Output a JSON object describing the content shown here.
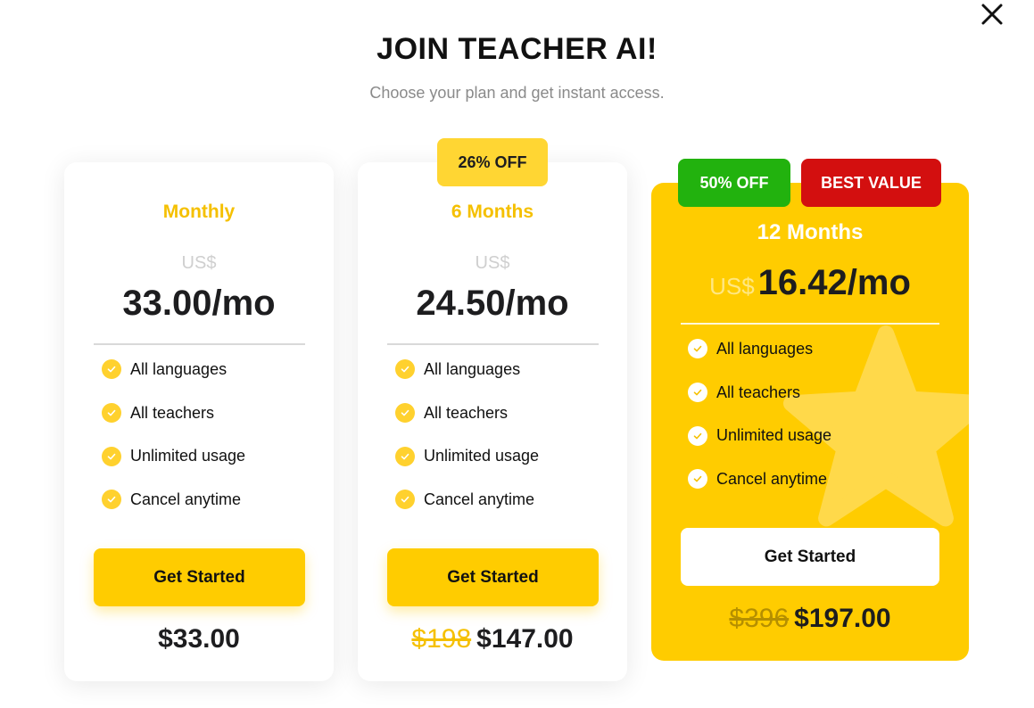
{
  "header": {
    "title": "JOIN TEACHER AI!",
    "subtitle": "Choose your plan and get instant access."
  },
  "features": [
    "All languages",
    "All teachers",
    "Unlimited usage",
    "Cancel anytime"
  ],
  "colors": {
    "brand_yellow": "#FFCC00",
    "discount_green": "#22B20E",
    "best_value_red": "#D30F0F"
  },
  "plans": [
    {
      "name": "Monthly",
      "currency": "US$",
      "price": "33.00/mo",
      "cta": "Get Started",
      "total": "$33.00"
    },
    {
      "name": "6 Months",
      "badge": "26% OFF",
      "currency": "US$",
      "price": "24.50/mo",
      "cta": "Get Started",
      "total_original": "$198",
      "total": "$147.00"
    },
    {
      "name": "12 Months",
      "badges": [
        "50% OFF",
        "BEST VALUE"
      ],
      "currency": "US$",
      "price": "16.42/mo",
      "cta": "Get Started",
      "total_original": "$396",
      "total": "$197.00"
    }
  ]
}
